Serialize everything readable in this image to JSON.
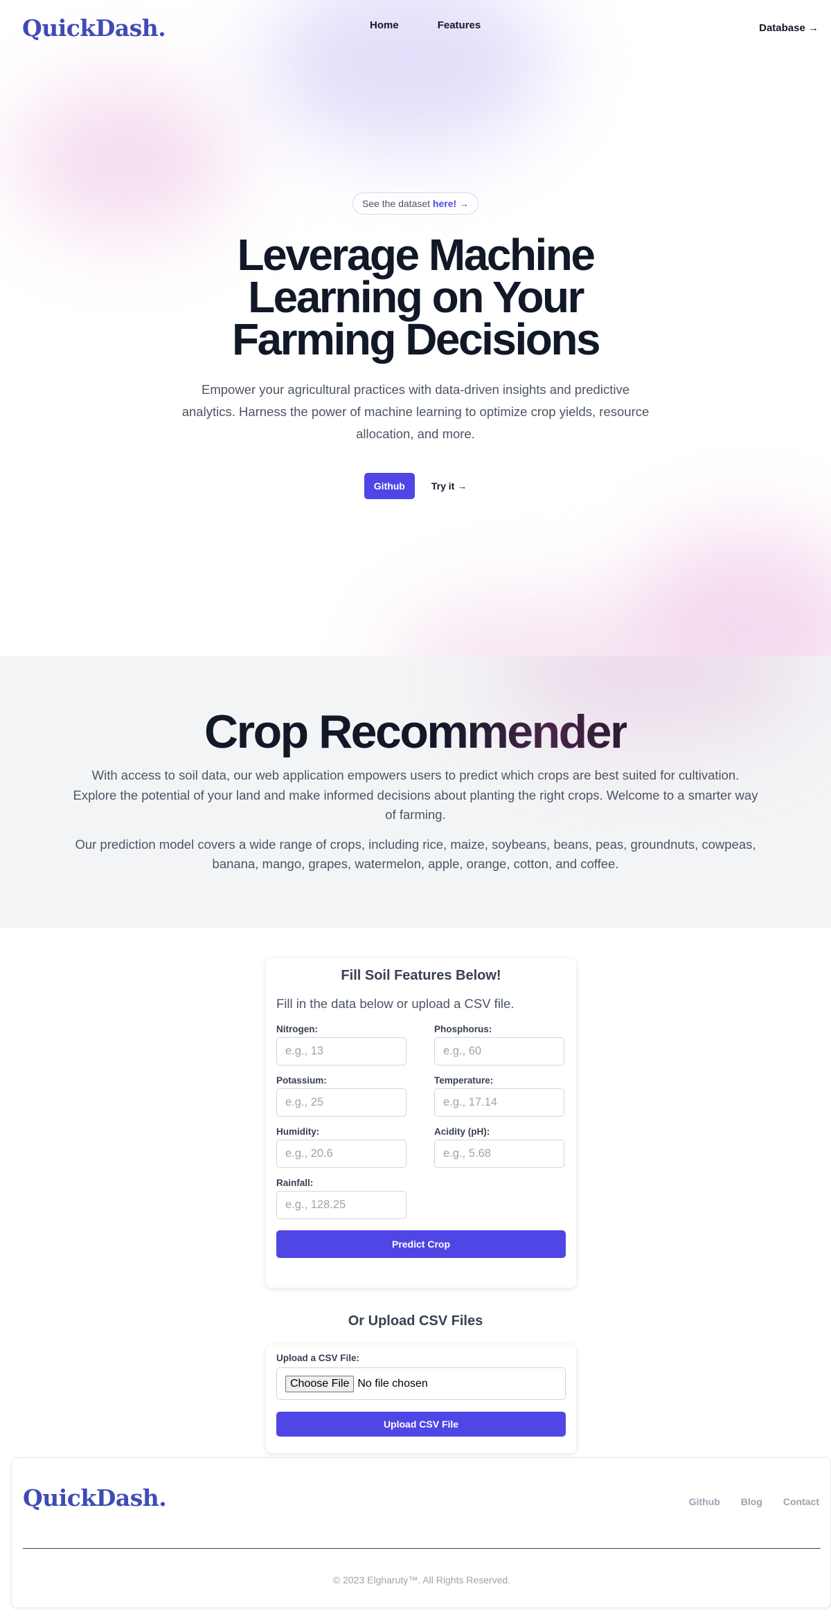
{
  "nav": {
    "logo_text": "QuickDash.",
    "links": [
      "Home",
      "Features"
    ],
    "right_link": "Database →"
  },
  "hero": {
    "pill_text": "See the dataset",
    "pill_link": "here! →",
    "title": "Leverage Machine Learning on Your Farming Decisions",
    "description": "Empower your agricultural practices with data-driven insights and predictive analytics. Harness the power of machine learning to optimize crop yields, resource allocation, and more.",
    "primary_button": "Github",
    "secondary_link": "Try it →"
  },
  "crop": {
    "title": "Crop Recommender",
    "paragraph1": "With access to soil data, our web application empowers users to predict which crops are best suited for cultivation. Explore the potential of your land and make informed decisions about planting the right crops. Welcome to a smarter way of farming.",
    "paragraph2": "Our prediction model covers a wide range of crops, including rice, maize, soybeans, beans, peas, groundnuts, cowpeas, banana, mango, grapes, watermelon, apple, orange, cotton, and coffee."
  },
  "form": {
    "title": "Fill Soil Features Below!",
    "subtitle": "Fill in the data below or upload a CSV file.",
    "fields": [
      {
        "label": "Nitrogen:",
        "placeholder": "e.g., 13",
        "value": ""
      },
      {
        "label": "Phosphorus:",
        "placeholder": "e.g., 60",
        "value": ""
      },
      {
        "label": "Potassium:",
        "placeholder": "e.g., 25",
        "value": ""
      },
      {
        "label": "Temperature:",
        "placeholder": "e.g., 17.14",
        "value": ""
      },
      {
        "label": "Humidity:",
        "placeholder": "e.g., 20.6",
        "value": ""
      },
      {
        "label": "Acidity (pH):",
        "placeholder": "e.g., 5.68",
        "value": ""
      },
      {
        "label": "Rainfall:",
        "placeholder": "e.g., 128.25",
        "value": ""
      }
    ],
    "submit_button": "Predict Crop"
  },
  "upload": {
    "heading": "Or Upload CSV Files",
    "label": "Upload a CSV File:",
    "choose_button": "Choose File",
    "status": "No file chosen",
    "submit_button": "Upload CSV File"
  },
  "footer": {
    "logo_text": "QuickDash.",
    "links": [
      "Github",
      "Blog",
      "Contact"
    ],
    "copyright": "© 2023 Elgharuty™. All Rights Reserved."
  },
  "colors": {
    "accent": "#4f46e5",
    "logo": "#3f4bb5",
    "heading": "#111827",
    "section_bg": "#f3f4f6"
  }
}
